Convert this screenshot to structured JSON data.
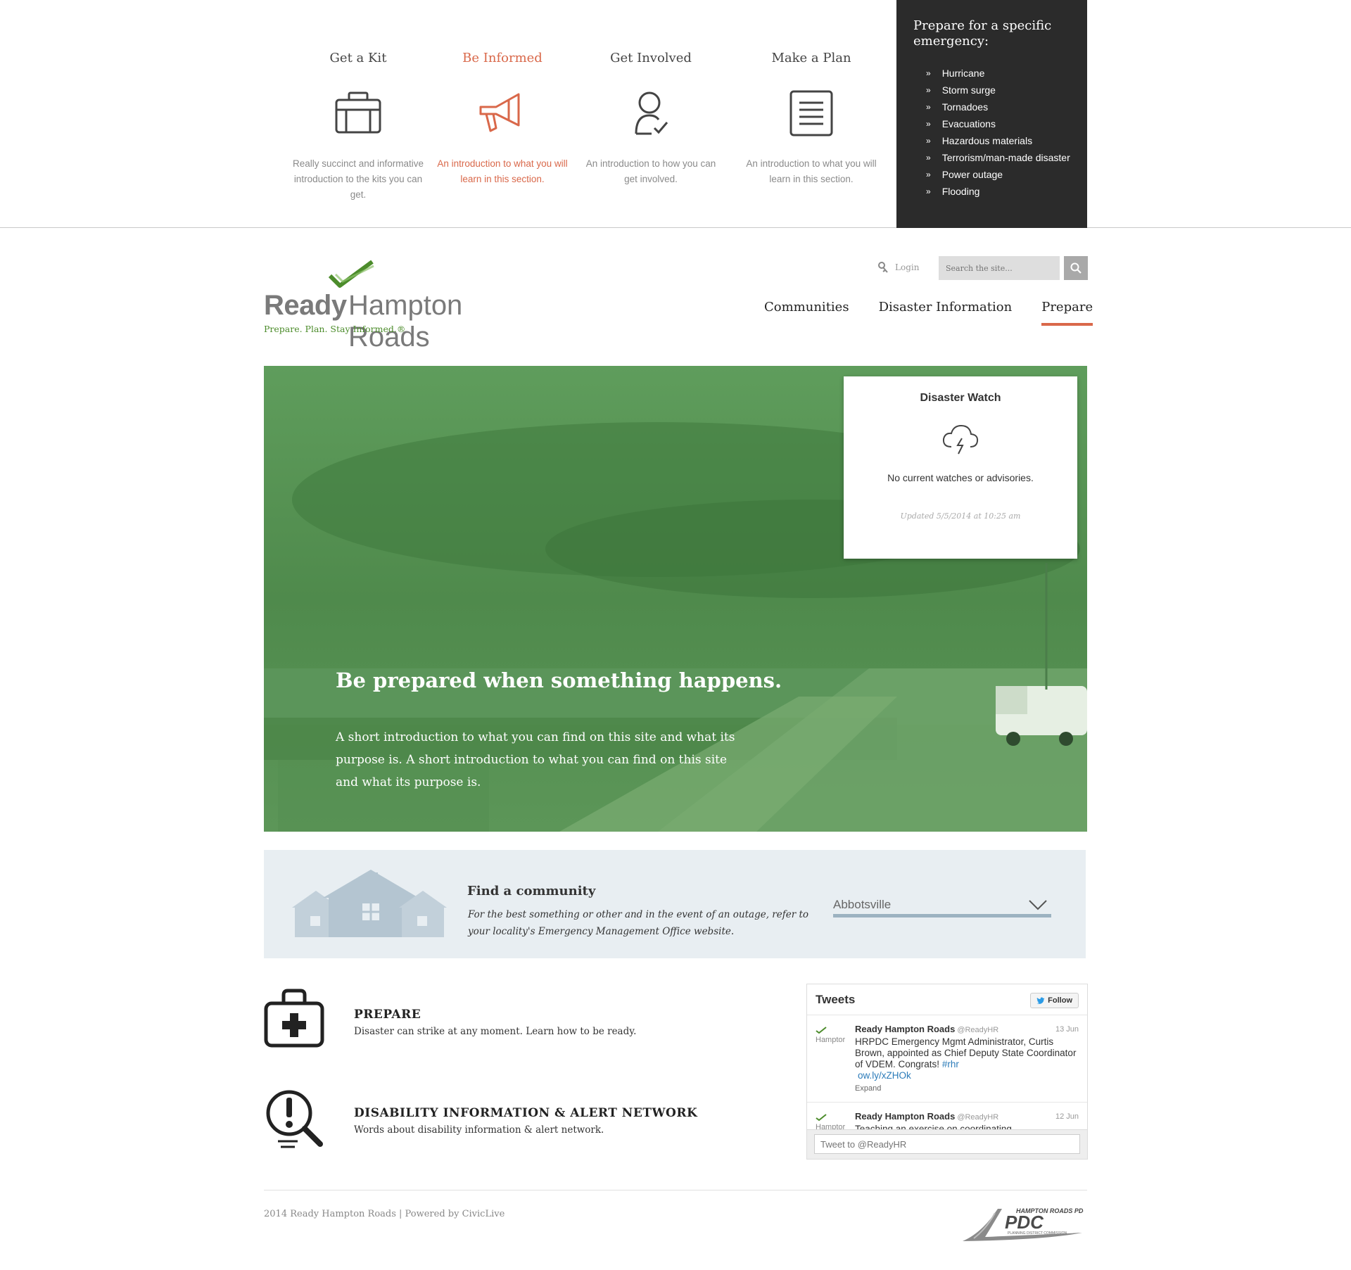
{
  "megamenu": {
    "columns": [
      {
        "title": "Get a Kit",
        "desc": "Really succinct and informative introduction to the kits you can get.",
        "icon": "toolbox-icon"
      },
      {
        "title": "Be Informed",
        "desc": "An introduction to what you will learn in this section.",
        "icon": "megaphone-icon"
      },
      {
        "title": "Get Involved",
        "desc": "An introduction to how you can get involved.",
        "icon": "person-check-icon"
      },
      {
        "title": "Make a Plan",
        "desc": "An introduction to what you will learn in this section.",
        "icon": "document-list-icon"
      }
    ],
    "specific": {
      "title": "Prepare for a specific emergency:",
      "items": [
        "Hurricane",
        "Storm surge",
        "Tornadoes",
        "Evacuations",
        "Hazardous materials",
        "Terrorism/man-made disaster",
        "Power outage",
        "Flooding"
      ],
      "bullet": "»"
    }
  },
  "logo": {
    "ready": "Ready",
    "name": "Hampton Roads",
    "tagline": "Prepare. Plan. Stay Informed.®"
  },
  "header": {
    "login": "Login",
    "search_placeholder": "Search the site...",
    "nav": [
      "Communities",
      "Disaster Information",
      "Prepare"
    ]
  },
  "hero": {
    "title": "Be prepared when something happens.",
    "text": "A short introduction to what you can find on this site and what its purpose is. A short introduction to what you can find on this site and what its purpose is.",
    "watch": {
      "title": "Disaster Watch",
      "message": "No current watches or advisories.",
      "updated": "Updated 5/5/2014 at 10:25 am"
    }
  },
  "community": {
    "title": "Find a community",
    "desc": "For the best something or other and in the event of an outage, refer to your locality's Emergency Management Office website.",
    "selected": "Abbotsville"
  },
  "features": [
    {
      "title": "PREPARE",
      "desc": "Disaster can strike at any moment. Learn how to be ready.",
      "icon": "first-aid-kit-icon"
    },
    {
      "title": "DISABILITY INFORMATION & ALERT NETWORK",
      "desc": "Words about disability information & alert network.",
      "icon": "alert-magnifier-icon"
    }
  ],
  "tweets": {
    "title": "Tweets",
    "follow": "Follow",
    "items": [
      {
        "avatar": "Hamptor",
        "name": "Ready Hampton Roads",
        "handle": "@ReadyHR",
        "date": "13 Jun",
        "text": "HRPDC Emergency Mgmt Administrator, Curtis Brown, appointed as Chief Deputy State Coordinator of VDEM. Congrats!",
        "hashtag": "#rhr",
        "link": "ow.ly/xZHOk",
        "expand": "Expand"
      },
      {
        "avatar": "Hamptor",
        "name": "Ready Hampton Roads",
        "handle": "@ReadyHR",
        "date": "12 Jun",
        "text": "Teaching an exercise on coordinating"
      }
    ],
    "compose_placeholder": "Tweet to @ReadyHR"
  },
  "footer": {
    "text": "2014 Ready Hampton Roads | Powered by CivicLive",
    "partner_logo": "HAMPTON ROADS PDC",
    "partner_sub": "PLANNING DISTRICT COMMISSION"
  },
  "colors": {
    "accent": "#d9684a",
    "brand_green": "#4c8c2b",
    "dark_panel": "#2b2b2b",
    "community_bg": "#e8eef2"
  }
}
